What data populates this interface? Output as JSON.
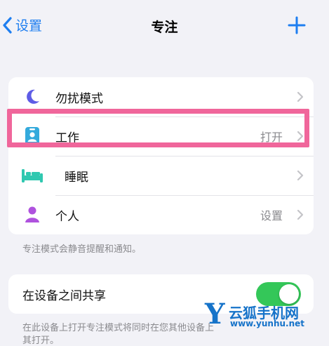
{
  "nav": {
    "back_label": "设置",
    "title": "专注"
  },
  "focus_modes": [
    {
      "label": "勿扰模式",
      "value": "",
      "icon": "moon-icon",
      "color": "#5e5ce6"
    },
    {
      "label": "工作",
      "value": "打开",
      "icon": "id-badge-icon",
      "color": "#34aadc"
    },
    {
      "label": "睡眠",
      "value": "",
      "icon": "bed-icon",
      "color": "#30c8b0"
    },
    {
      "label": "个人",
      "value": "设置",
      "icon": "person-icon",
      "color": "#af52de"
    }
  ],
  "focus_footnote": "专注模式会静音提醒和通知。",
  "share": {
    "label": "在设备之间共享",
    "enabled": true,
    "footnote_line1": "在此设备上打开专注模式将同时在您其他设备上",
    "footnote_line2": "其打开。"
  },
  "watermark": {
    "letter": "Y",
    "name": "云狐手机网",
    "url": "www.yunhu.net"
  },
  "colors": {
    "accent": "#1e7ef0",
    "highlight": "#f0669b",
    "toggle_on": "#34c759"
  }
}
